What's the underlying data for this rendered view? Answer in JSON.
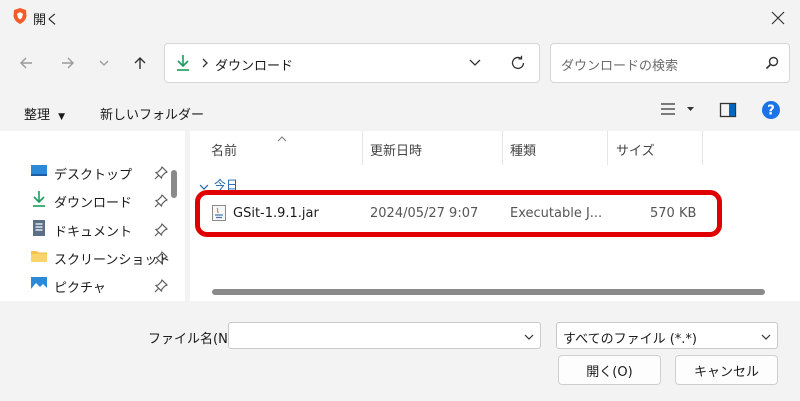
{
  "window": {
    "title": "開く"
  },
  "address": {
    "segment": "ダウンロード"
  },
  "search": {
    "placeholder": "ダウンロードの検索"
  },
  "commands": {
    "organize": "整理",
    "new_folder": "新しいフォルダー"
  },
  "nav_items": [
    {
      "label": "デスクトップ",
      "icon": "desktop-icon"
    },
    {
      "label": "ダウンロード",
      "icon": "download-icon"
    },
    {
      "label": "ドキュメント",
      "icon": "document-icon"
    },
    {
      "label": "スクリーンショット",
      "icon": "folder-icon"
    },
    {
      "label": "ピクチャ",
      "icon": "pictures-icon"
    }
  ],
  "columns": {
    "name": "名前",
    "date": "更新日時",
    "type": "種類",
    "size": "サイズ"
  },
  "group": {
    "label": "今日"
  },
  "files": [
    {
      "name": "GSit-1.9.1.jar",
      "date": "2024/05/27 9:07",
      "type": "Executable J...",
      "size": "570 KB",
      "icon": "java-file-icon"
    }
  ],
  "footer": {
    "filename_label": "ファイル名(N):",
    "filename_value": "",
    "filter": "すべてのファイル (*.*)",
    "open": "開く(O)",
    "cancel": "キャンセル"
  },
  "colors": {
    "highlight": "#e00000",
    "accent": "#0067c0",
    "help": "#1a73e8",
    "download_arrow": "#1a9c5a"
  }
}
